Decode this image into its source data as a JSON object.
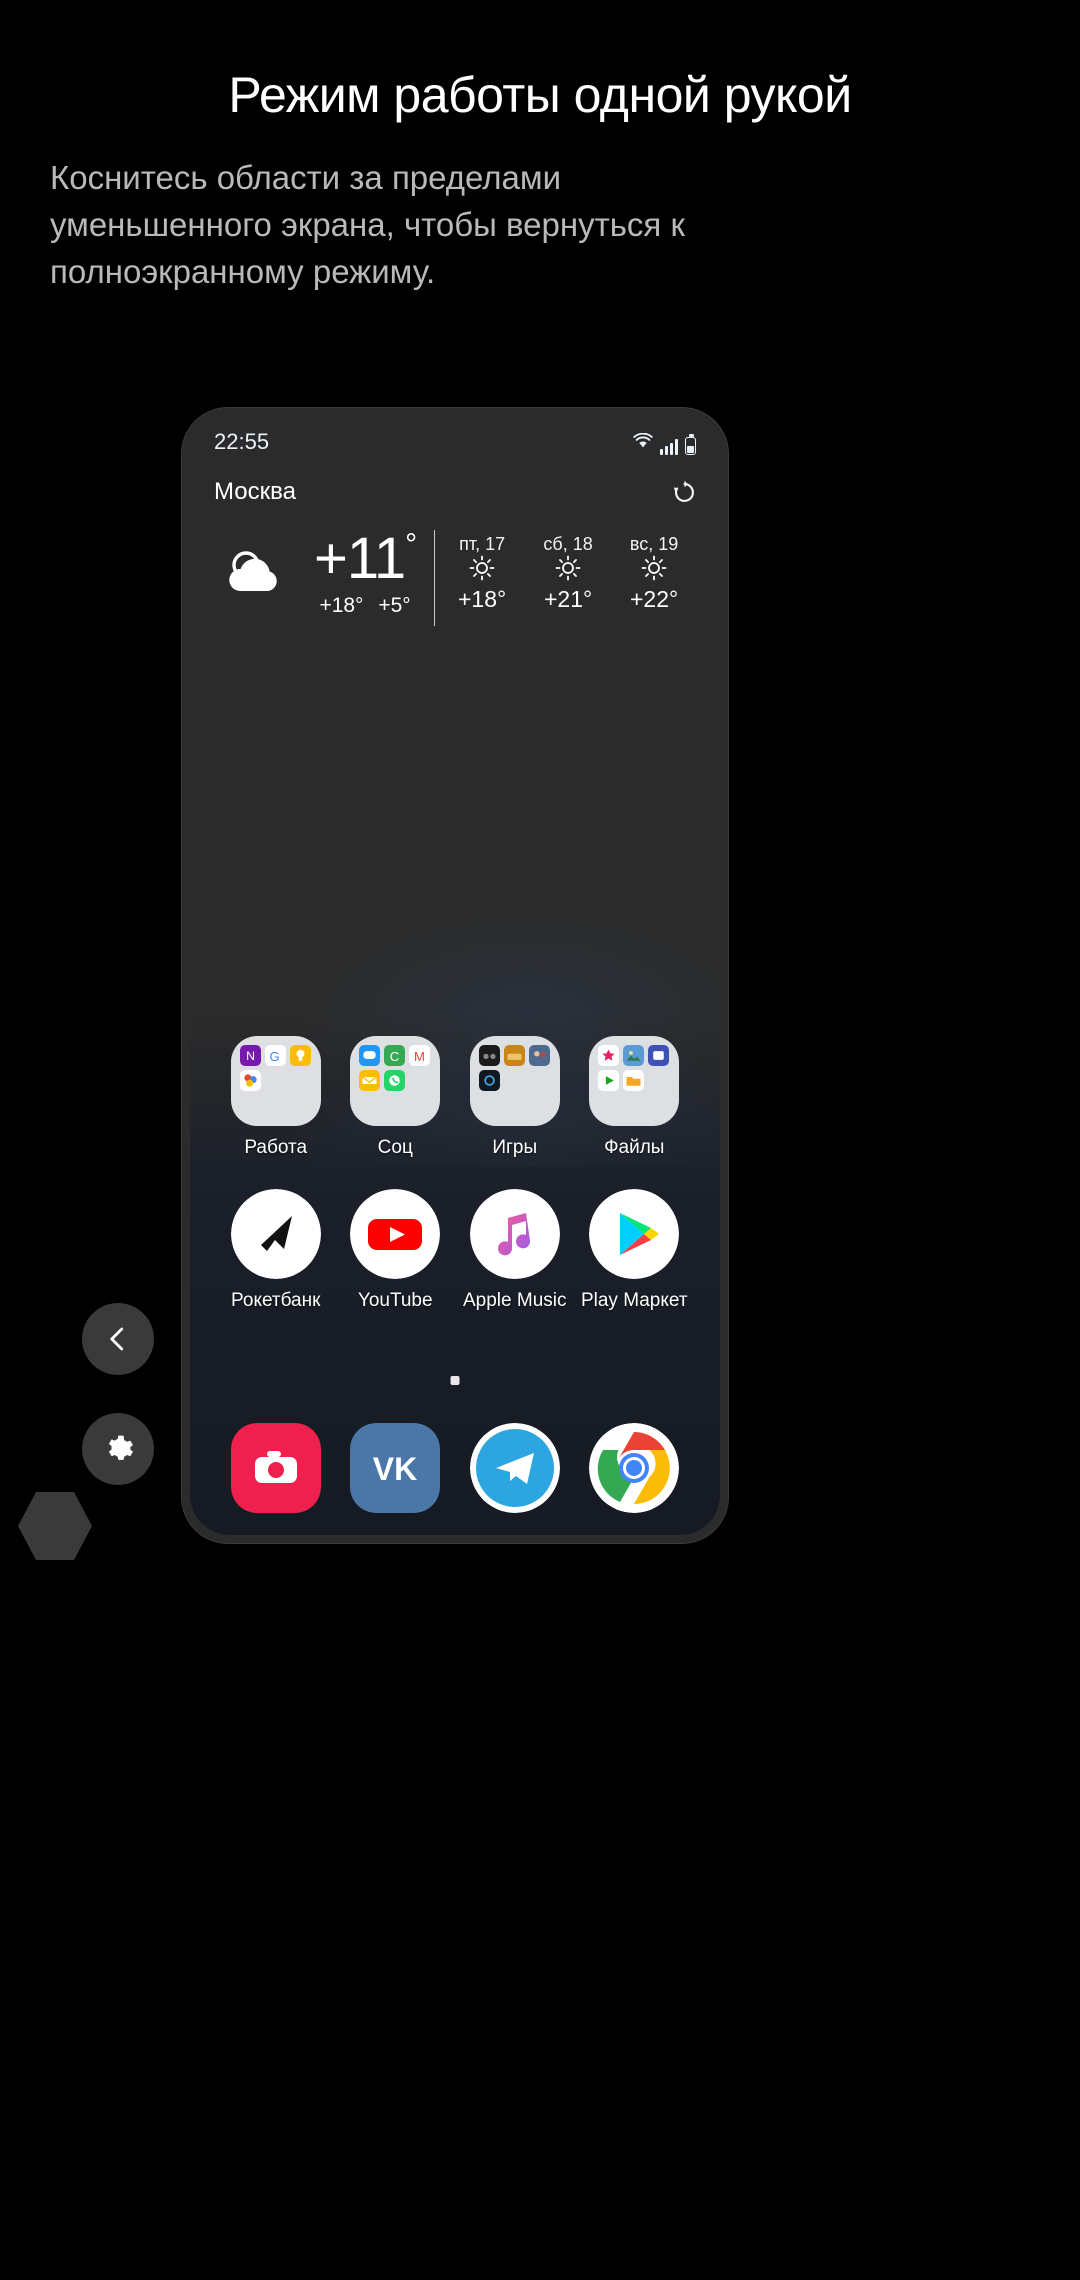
{
  "intro": {
    "title": "Режим работы одной рукой",
    "subtitle": "Коснитесь области за пределами уменьшенного экрана, чтобы вернуться к полноэкранному режиму."
  },
  "phone": {
    "status_bar": {
      "time": "22:55",
      "icons": [
        "wifi-icon",
        "signal-icon",
        "battery-icon"
      ]
    },
    "weather": {
      "city": "Москва",
      "refresh_icon": "refresh-icon",
      "condition_icon": "cloudy-icon",
      "current_temp": "+11",
      "degree": "°",
      "high": "+18°",
      "low": "+5°",
      "forecast": [
        {
          "label": "пт, 17",
          "icon": "sun-icon",
          "temp": "+18°"
        },
        {
          "label": "сб, 18",
          "icon": "sun-icon",
          "temp": "+21°"
        },
        {
          "label": "вс, 19",
          "icon": "sun-icon",
          "temp": "+22°"
        }
      ]
    },
    "home": {
      "folders": [
        {
          "label": "Работа"
        },
        {
          "label": "Соц"
        },
        {
          "label": "Игры"
        },
        {
          "label": "Файлы"
        }
      ],
      "apps": [
        {
          "label": "Рокетбанк",
          "icon": "rocketbank-icon"
        },
        {
          "label": "YouTube",
          "icon": "youtube-icon"
        },
        {
          "label": "Apple Music",
          "icon": "apple-music-icon"
        },
        {
          "label": "Play Маркет",
          "icon": "play-store-icon"
        }
      ],
      "dock": [
        {
          "icon": "camera-icon"
        },
        {
          "icon": "vk-icon"
        },
        {
          "icon": "telegram-icon"
        },
        {
          "icon": "chrome-icon"
        }
      ],
      "page_indicator": "page-dot"
    }
  },
  "floating": {
    "back_button": "back-chevron-icon",
    "settings_button": "gear-icon",
    "corner_shape": "hexagon-icon"
  },
  "colors": {
    "background": "#000000",
    "title_text": "#ffffff",
    "subtitle_text": "#b9b9b9",
    "phone_bezel": "#2b2b2b",
    "sky": "#6a9fd0",
    "fab": "#3a3a3a"
  }
}
